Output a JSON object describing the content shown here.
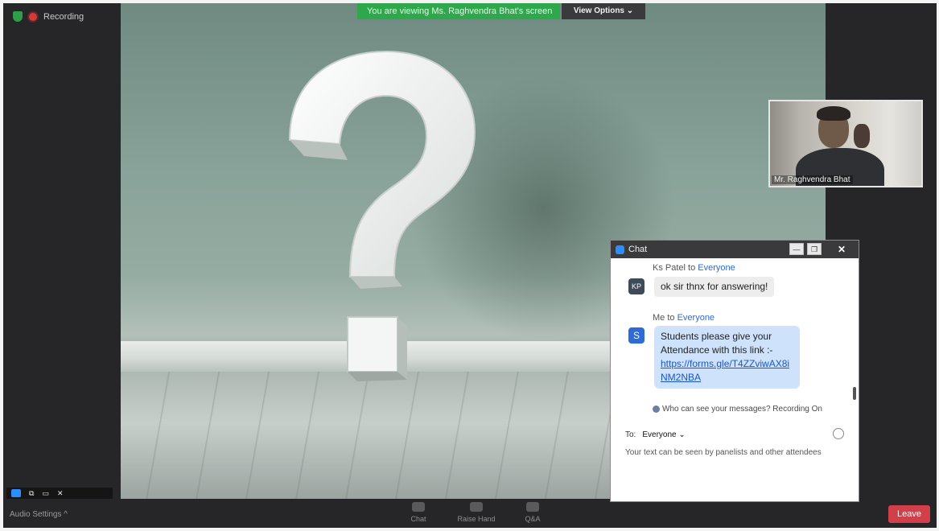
{
  "top": {
    "recording_label": "Recording",
    "share_banner": "You are viewing Ms. Raghvendra Bhat's screen",
    "view_options": "View Options ⌄"
  },
  "video": {
    "participant_name": "Mr. Raghvendra Bhat"
  },
  "chat": {
    "title": "Chat",
    "messages": [
      {
        "sender": "Ks Patel",
        "to_word": " to ",
        "recipient": "Everyone",
        "avatar": "KP",
        "avatar_color": "#3d4a57",
        "text": "ok sir thnx for answering!"
      },
      {
        "sender": "Me",
        "to_word": " to ",
        "recipient": "Everyone",
        "avatar": "S",
        "avatar_color": "#2d6bd6",
        "text_line1": "Students  please give your",
        "text_line2": "Attendance with this link :-",
        "link": "https://forms.gle/T4ZZviwAX8iNM2NBA"
      }
    ],
    "privacy_note": "Who can see your messages? Recording On",
    "to_label": "To:",
    "to_value": "Everyone ⌄",
    "input_placeholder": "Your text can be seen by panelists and other attendees"
  },
  "toolbar": {
    "audio_settings": "Audio Settings ^",
    "chat": "Chat",
    "raise_hand": "Raise Hand",
    "qa": "Q&A",
    "leave": "Leave"
  },
  "icons": {
    "security": "shield-icon",
    "recording": "record-dot-icon",
    "chat_logo": "chat-logo-icon",
    "privacy": "person-icon",
    "emoji": "emoji-icon"
  },
  "colors": {
    "share_banner": "#2fa84d",
    "leave_button": "#d1404a",
    "link": "#1857c9",
    "my_bubble": "#cfe2fb"
  }
}
